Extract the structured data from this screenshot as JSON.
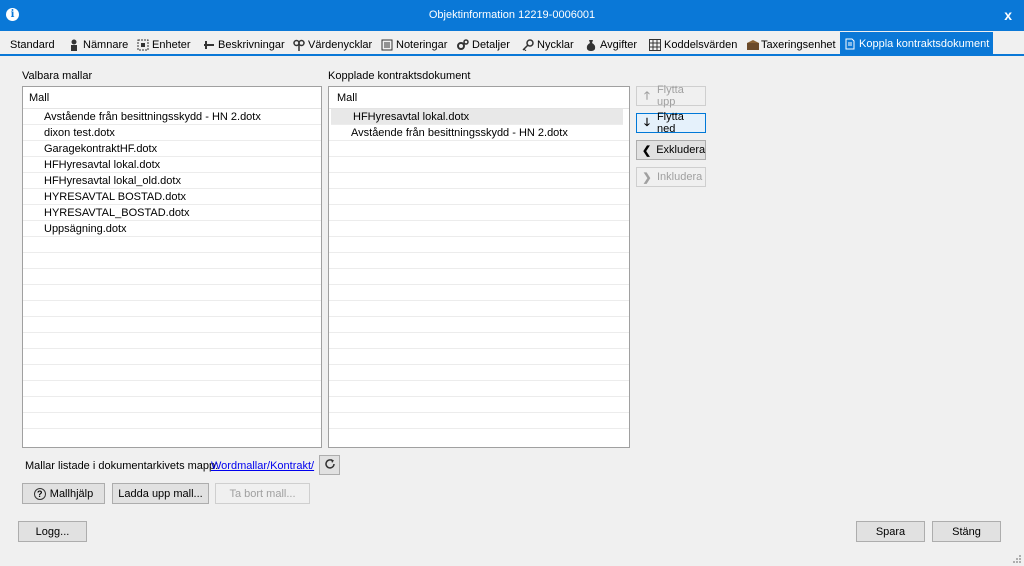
{
  "window": {
    "title": "Objektinformation 12219-0006001",
    "close_glyph": "x",
    "app_icon": "i"
  },
  "tabs": [
    {
      "label": "Standard",
      "icon": "none"
    },
    {
      "label": "Nämnare",
      "icon": "person-icon"
    },
    {
      "label": "Enheter",
      "icon": "units-icon"
    },
    {
      "label": "Beskrivningar",
      "icon": "pen-icon"
    },
    {
      "label": "Värdenycklar",
      "icon": "value-key-icon"
    },
    {
      "label": "Noteringar",
      "icon": "notes-icon"
    },
    {
      "label": "Detaljer",
      "icon": "gears-icon"
    },
    {
      "label": "Nycklar",
      "icon": "key-icon"
    },
    {
      "label": "Avgifter",
      "icon": "money-bag-icon"
    },
    {
      "label": "Koddelsvärden",
      "icon": "grid-icon"
    },
    {
      "label": "Taxeringsenhet",
      "icon": "tax-icon"
    },
    {
      "label": "Koppla kontraktsdokument",
      "icon": "document-link-icon",
      "active": true
    }
  ],
  "available": {
    "label": "Valbara mallar",
    "header": "Mall",
    "items": [
      "Avstående från besittningsskydd - HN 2.dotx",
      "dixon test.dotx",
      "GaragekontraktHF.dotx",
      "HFHyresavtal lokal.dotx",
      "HFHyresavtal lokal_old.dotx",
      "HYRESAVTAL BOSTAD.dotx",
      "HYRESAVTAL_BOSTAD.dotx",
      "Uppsägning.dotx"
    ]
  },
  "linked": {
    "label": "Kopplade kontraktsdokument",
    "header": "Mall",
    "items": [
      "HFHyresavtal lokal.dotx",
      "Avstående från besittningsskydd - HN 2.dotx"
    ],
    "selected_index": 0
  },
  "side_buttons": {
    "up": "Flytta upp",
    "down": "Flytta ned",
    "exclude": "Exkludera",
    "include": "Inkludera"
  },
  "folder": {
    "label": "Mallar listade i dokumentarkivets mapp:",
    "link": "Wordmallar/Kontrakt/"
  },
  "buttons": {
    "help": "Mallhjälp",
    "upload": "Ladda upp mall...",
    "remove": "Ta bort mall...",
    "log": "Logg...",
    "save": "Spara",
    "close": "Stäng"
  },
  "colors": {
    "accent": "#0a78d7",
    "link": "#0000ee"
  }
}
